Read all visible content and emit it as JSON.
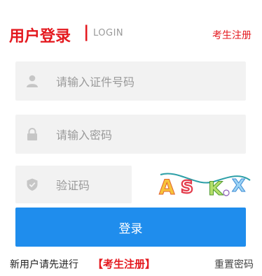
{
  "header": {
    "title": "用户登录",
    "separator": "|",
    "subtitle": "LOGIN",
    "register_link": "考生注册"
  },
  "form": {
    "id_number_placeholder": "请输入证件号码",
    "password_placeholder": "请输入密码",
    "captcha_placeholder": "验证码",
    "captcha_image": {
      "text": "ASKX"
    },
    "login_button": "登录"
  },
  "footer": {
    "hint": "新用户请先进行",
    "register_link": "【考生注册】",
    "reset_password": "重置密码"
  },
  "colors": {
    "brand_red": "#e4191f",
    "primary_blue": "#1f8ded",
    "field_bg": "#f2f2f2",
    "icon_gray": "#c6c6c6"
  },
  "icons": {
    "id_field": "user-icon",
    "password_field": "lock-icon",
    "captcha_field": "shield-icon"
  }
}
